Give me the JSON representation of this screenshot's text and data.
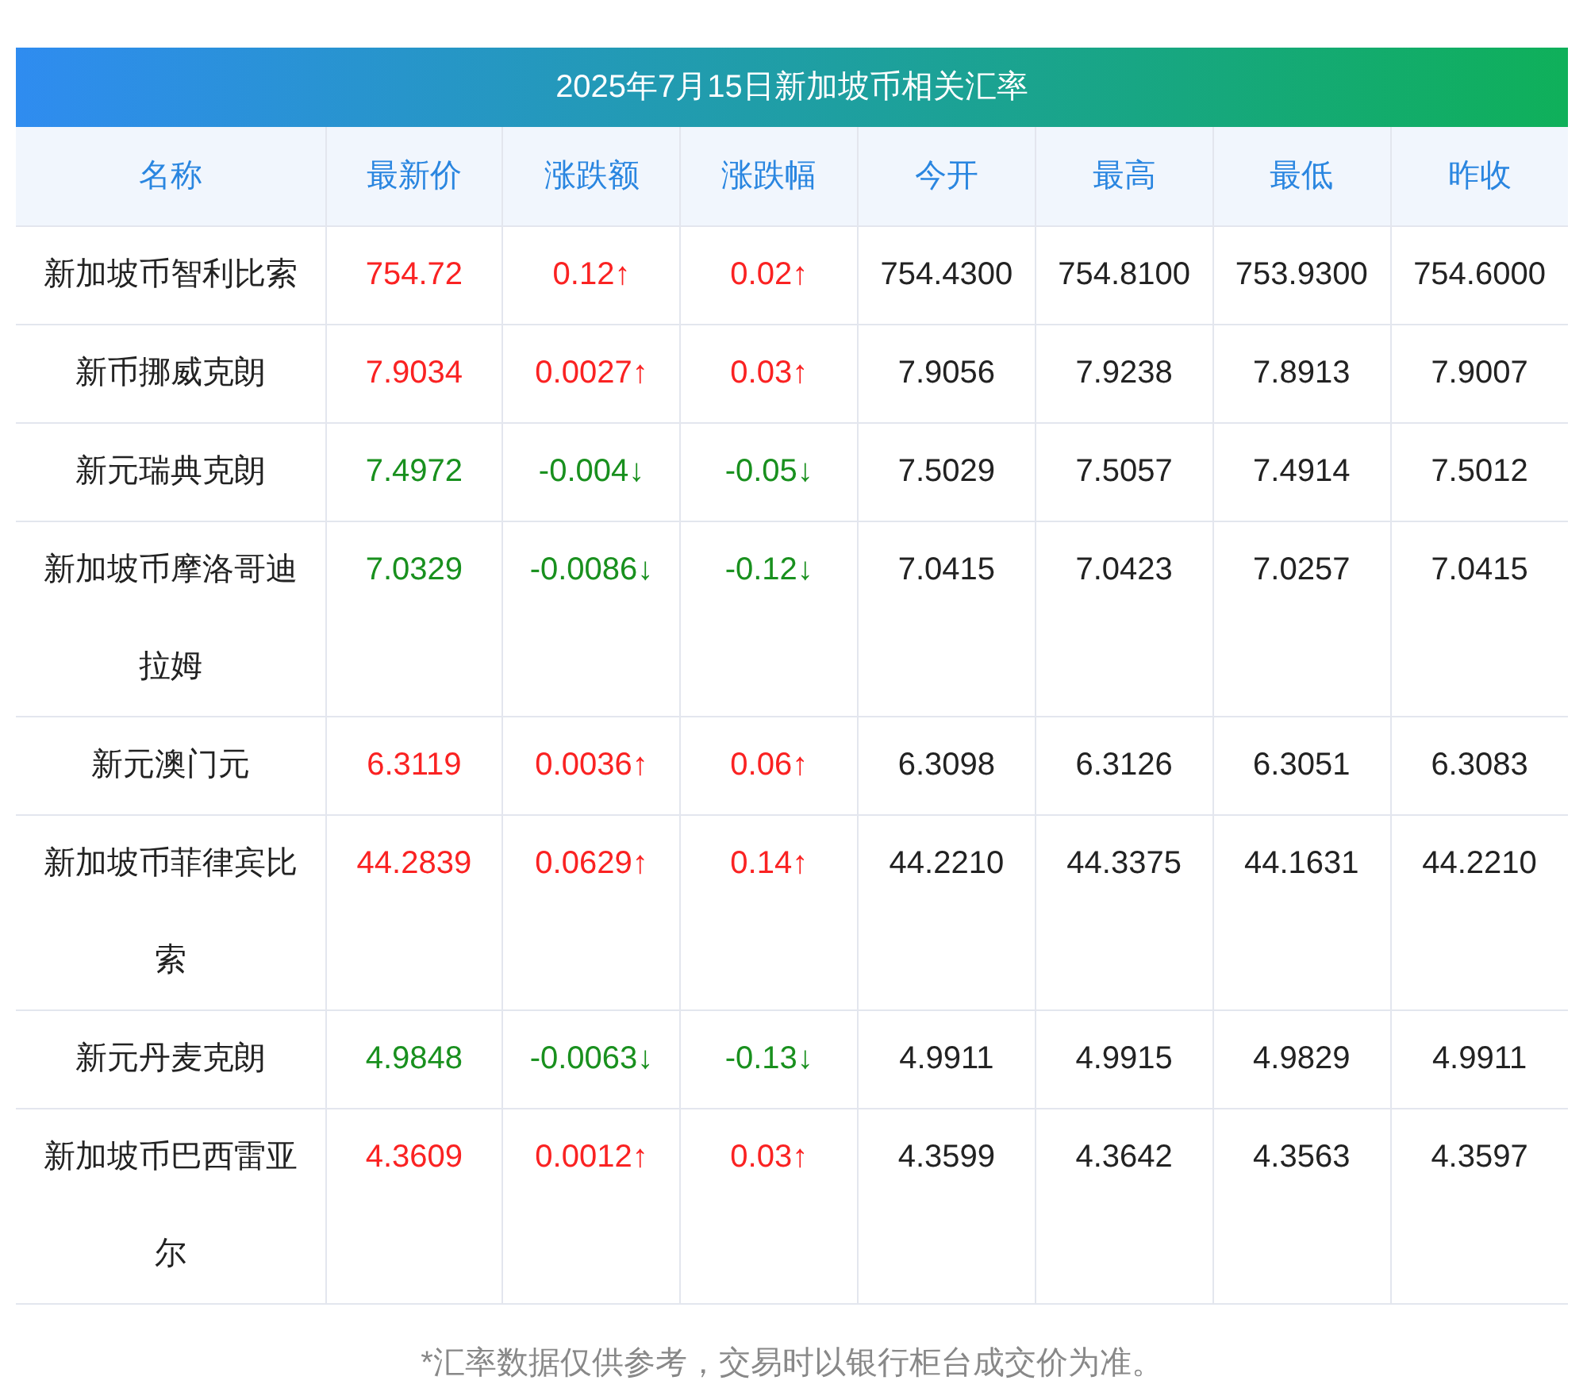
{
  "title": "2025年7月15日新加坡币相关汇率",
  "columns": [
    "名称",
    "最新价",
    "涨跌额",
    "涨跌幅",
    "今开",
    "最高",
    "最低",
    "昨收"
  ],
  "rows": [
    {
      "name": "新加坡币智利比索",
      "kind": "up",
      "price": "754.72",
      "change": "0.12↑",
      "pct": "0.02↑",
      "open": "754.4300",
      "high": "754.8100",
      "low": "753.9300",
      "prev": "754.6000"
    },
    {
      "name": "新币挪威克朗",
      "kind": "up",
      "price": "7.9034",
      "change": "0.0027↑",
      "pct": "0.03↑",
      "open": "7.9056",
      "high": "7.9238",
      "low": "7.8913",
      "prev": "7.9007"
    },
    {
      "name": "新元瑞典克朗",
      "kind": "down",
      "price": "7.4972",
      "change": "-0.004↓",
      "pct": "-0.05↓",
      "open": "7.5029",
      "high": "7.5057",
      "low": "7.4914",
      "prev": "7.5012"
    },
    {
      "name": "新加坡币摩洛哥迪拉姆",
      "kind": "down",
      "price": "7.0329",
      "change": "-0.0086↓",
      "pct": "-0.12↓",
      "open": "7.0415",
      "high": "7.0423",
      "low": "7.0257",
      "prev": "7.0415"
    },
    {
      "name": "新元澳门元",
      "kind": "up",
      "price": "6.3119",
      "change": "0.0036↑",
      "pct": "0.06↑",
      "open": "6.3098",
      "high": "6.3126",
      "low": "6.3051",
      "prev": "6.3083"
    },
    {
      "name": "新加坡币菲律宾比索",
      "kind": "up",
      "price": "44.2839",
      "change": "0.0629↑",
      "pct": "0.14↑",
      "open": "44.2210",
      "high": "44.3375",
      "low": "44.1631",
      "prev": "44.2210"
    },
    {
      "name": "新元丹麦克朗",
      "kind": "down",
      "price": "4.9848",
      "change": "-0.0063↓",
      "pct": "-0.13↓",
      "open": "4.9911",
      "high": "4.9915",
      "low": "4.9829",
      "prev": "4.9911"
    },
    {
      "name": "新加坡币巴西雷亚尔",
      "kind": "up",
      "price": "4.3609",
      "change": "0.0012↑",
      "pct": "0.03↑",
      "open": "4.3599",
      "high": "4.3642",
      "low": "4.3563",
      "prev": "4.3597"
    }
  ],
  "footnote": "*汇率数据仅供参考，交易时以银行柜台成交价为准。"
}
